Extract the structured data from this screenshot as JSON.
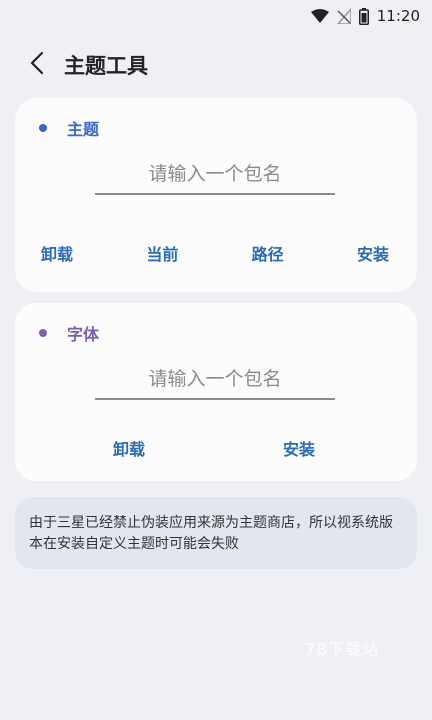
{
  "status_bar": {
    "time": "11:20"
  },
  "app_bar": {
    "title": "主题工具"
  },
  "theme_card": {
    "title": "主题",
    "accent": "#3a66c8",
    "placeholder": "请输入一个包名",
    "actions": [
      "卸载",
      "当前",
      "路径",
      "安装"
    ]
  },
  "font_card": {
    "title": "字体",
    "accent": "#7a5fb3",
    "placeholder": "请输入一个包名",
    "actions": [
      "卸载",
      "安装"
    ]
  },
  "note": {
    "text": "由于三星已经禁止伪装应用来源为主题商店，所以视系统版本在安装自定义主题时可能会失败"
  },
  "watermark": {
    "text": "7B下载站"
  },
  "colors": {
    "action": "#2a6bb3",
    "background": "#eef0f5",
    "card": "#fcfcfd"
  }
}
